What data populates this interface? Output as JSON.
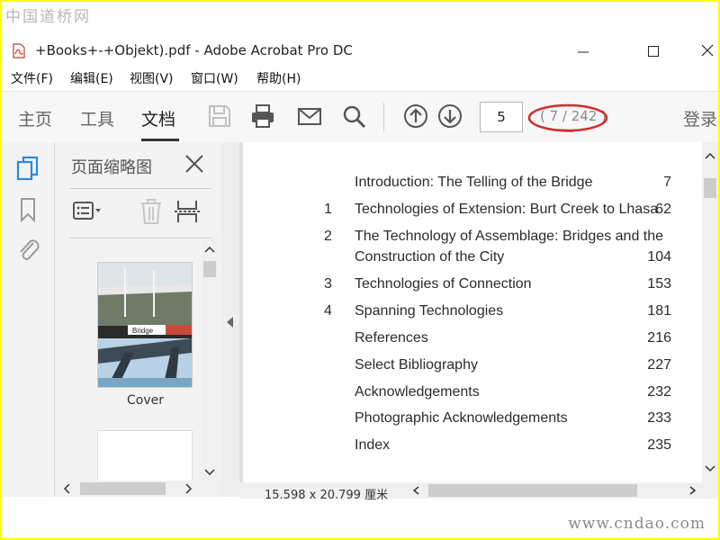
{
  "watermark": {
    "top": "中国道桥网",
    "bottom": "www.cndao.com"
  },
  "window": {
    "title": "+Books+-+Objekt).pdf - Adobe Acrobat Pro DC",
    "controls": {
      "minimize": "—",
      "maximize": "☐",
      "close": "✕"
    }
  },
  "menu": [
    "文件(F)",
    "编辑(E)",
    "视图(V)",
    "窗口(W)",
    "帮助(H)"
  ],
  "toolbar": {
    "tabs": [
      "主页",
      "工具",
      "文档"
    ],
    "active_tab": "文档",
    "page_input": "5",
    "page_count": "( 7 / 242 )",
    "login": "登录",
    "icons": [
      "save-icon",
      "print-icon",
      "email-icon",
      "search-icon",
      "prev-page-icon",
      "next-page-icon"
    ]
  },
  "leftnav": {
    "icons": [
      "page-thumbnails-icon",
      "bookmarks-icon",
      "attachments-icon"
    ]
  },
  "thumb_panel": {
    "title": "页面缩略图",
    "thumbnails": [
      {
        "label": "Cover",
        "text": "Bridge"
      }
    ]
  },
  "toc": [
    {
      "num": "",
      "title": "Introduction: The Telling of the Bridge",
      "page": "7"
    },
    {
      "num": "1",
      "title": "Technologies of Extension: Burt Creek to Lhasa",
      "page": "62"
    },
    {
      "num": "2",
      "title": "The Technology of Assemblage: Bridges and the",
      "page": ""
    },
    {
      "num": "",
      "title": "Construction of the City",
      "page": "104"
    },
    {
      "num": "3",
      "title": "Technologies of Connection",
      "page": "153"
    },
    {
      "num": "4",
      "title": "Spanning Technologies",
      "page": "181"
    },
    {
      "num": "",
      "title": "References",
      "page": "216"
    },
    {
      "num": "",
      "title": "Select Bibliography",
      "page": "227"
    },
    {
      "num": "",
      "title": "Acknowledgements",
      "page": "232"
    },
    {
      "num": "",
      "title": "Photographic Acknowledgements",
      "page": "233"
    },
    {
      "num": "",
      "title": "Index",
      "page": "235"
    }
  ],
  "status": {
    "page_size": "15.598 x 20.799 厘米"
  },
  "colors": {
    "accent_blue": "#2b88d8",
    "highlight_red": "#d42b2b",
    "watermark_frame": "#ffff00"
  }
}
